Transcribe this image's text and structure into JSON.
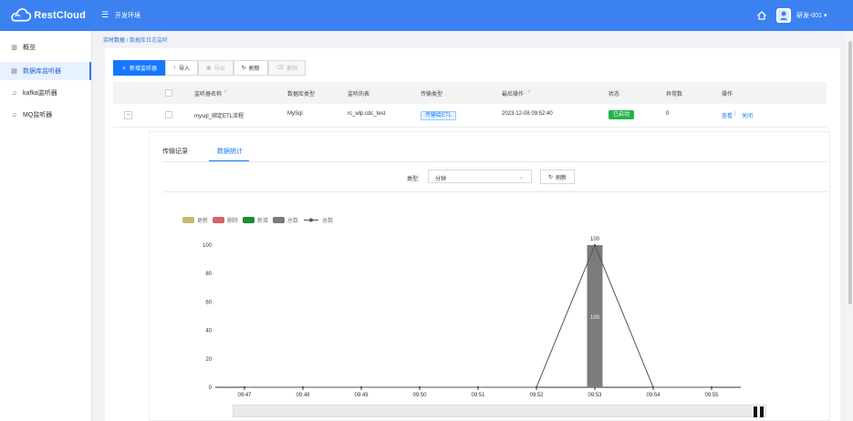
{
  "header": {
    "brand": "RestCloud",
    "environment": "开发环境",
    "user": "研发-001 ▾"
  },
  "sidebar": {
    "items": [
      {
        "label": "概览",
        "icon": "bar-chart-icon"
      },
      {
        "label": "数据库监听器",
        "icon": "document-icon",
        "active": true
      },
      {
        "label": "kafka监听器",
        "icon": "headphone-icon"
      },
      {
        "label": "MQ监听器",
        "icon": "headphone-icon"
      }
    ]
  },
  "breadcrumb": {
    "root": "实时数据",
    "separator": "/",
    "current": "数据库日志监听"
  },
  "toolbar": {
    "new_label": "新增监听器",
    "import_label": "导入",
    "export_label": "导出",
    "refresh_label": "刷新",
    "delete_label": "删除"
  },
  "table": {
    "headers": [
      "监听器名称",
      "数据库类型",
      "监听的表",
      "传输类型",
      "最后操作",
      "状态",
      "异常数",
      "操作"
    ],
    "row": {
      "name": "mysql_绑定ETL流程",
      "db_type": "MySql",
      "table": "rc_wlp.cdc_test",
      "transfer_type": "传输给ETL",
      "last_operation": "2023-12-08 09:52:40",
      "status": "已启动",
      "errors": "0",
      "action_view": "查看",
      "action_separator": "|",
      "action_close": "关闭"
    }
  },
  "detail": {
    "tabs": [
      "传输记录",
      "数据统计"
    ],
    "active_tab": "数据统计",
    "type_label": "类型:",
    "type_value": "分钟",
    "refresh_label": "刷新"
  },
  "colors": {
    "accent": "#1677ff",
    "header": "#3b82f0",
    "update": "#c4b971",
    "delete": "#d96363",
    "insert": "#1f8a31",
    "total": "#7b7b7b",
    "status": "#23b54d"
  },
  "chart_data": {
    "type": "bar",
    "categories": [
      "09:47",
      "09:48",
      "09:49",
      "09:50",
      "09:51",
      "09:52",
      "09:53",
      "09:54",
      "09:55"
    ],
    "series": [
      {
        "name": "更新",
        "type": "bar",
        "values": [
          0,
          0,
          0,
          0,
          0,
          0,
          0,
          0,
          0
        ]
      },
      {
        "name": "删除",
        "type": "bar",
        "values": [
          0,
          0,
          0,
          0,
          0,
          0,
          0,
          0,
          0
        ]
      },
      {
        "name": "新增",
        "type": "bar",
        "values": [
          0,
          0,
          0,
          0,
          0,
          0,
          0,
          0,
          0
        ]
      },
      {
        "name": "总数",
        "type": "bar",
        "values": [
          0,
          0,
          0,
          0,
          0,
          0,
          100,
          0,
          0
        ]
      },
      {
        "name": "总数",
        "type": "line",
        "values": [
          0,
          0,
          0,
          0,
          0,
          0,
          100,
          0,
          0
        ]
      }
    ],
    "y_ticks": [
      0,
      20,
      40,
      60,
      80,
      100
    ],
    "ylim": [
      0,
      100
    ],
    "data_labels": [
      "100",
      "100"
    ],
    "legend_position": "top-left",
    "grid": false
  }
}
